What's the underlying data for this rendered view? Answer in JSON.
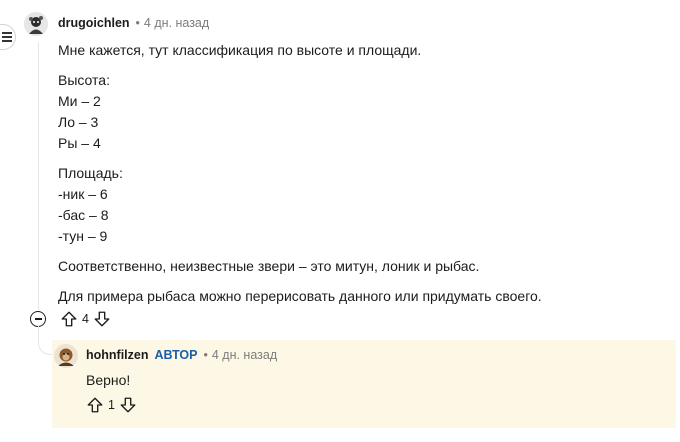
{
  "comment": {
    "username": "drugoichlen",
    "separator": "•",
    "time": "4 дн. назад",
    "paragraphs": [
      [
        "Мне кажется, тут классификация по высоте и площади."
      ],
      [
        "Высота:",
        "Ми – 2",
        "Ло – 3",
        "Ры – 4"
      ],
      [
        "Площадь:",
        "-ник – 6",
        "-бас – 8",
        "-тун – 9"
      ],
      [
        "Соответственно, неизвестные звери – это митун, лоник и рыбас."
      ],
      [
        "Для примера рыбаса можно перерисовать данного или придумать своего."
      ]
    ],
    "vote_count": "4"
  },
  "reply": {
    "username": "hohnfilzen",
    "badge": "АВТОР",
    "separator": "•",
    "time": "4 дн. назад",
    "text": "Верно!",
    "vote_count": "1"
  },
  "icons": {
    "menu": "menu-icon",
    "collapse": "collapse-thread-icon",
    "upvote": "upvote-arrow-icon",
    "downvote": "downvote-arrow-icon"
  },
  "colors": {
    "reply_background": "#fdf8e6",
    "author_badge": "#1a5ea8",
    "meta_text": "#7c7c7c"
  }
}
